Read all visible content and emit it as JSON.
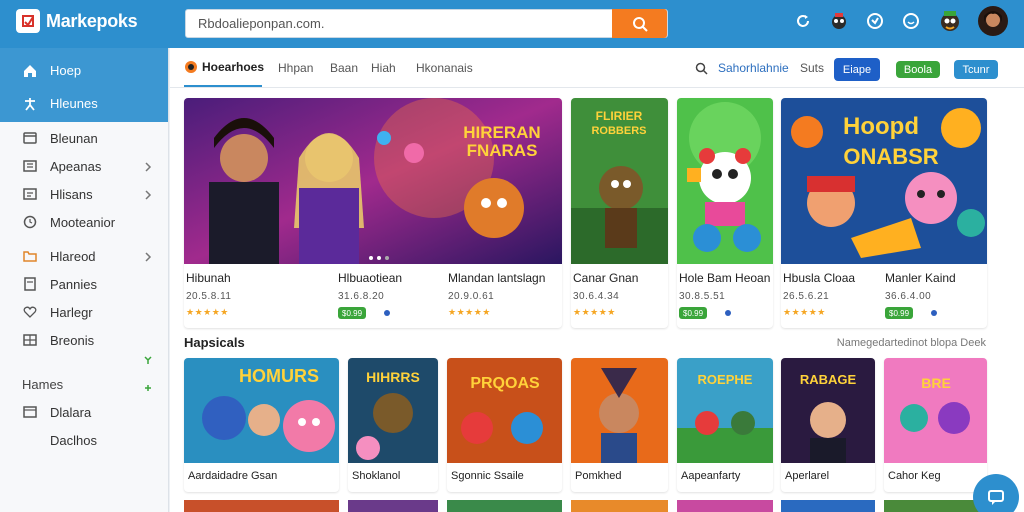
{
  "header": {
    "logo_text": "Markepoks",
    "search_value": "Rbdoalieponpan.com.",
    "search_placeholder": "Search"
  },
  "sidebar": {
    "top_items": [
      {
        "label": "Hoep",
        "icon": "home-icon"
      },
      {
        "label": "Hleunes",
        "icon": "figure-icon"
      }
    ],
    "items": [
      {
        "label": "Bleunan",
        "icon": "card-icon"
      },
      {
        "label": "Apeanas",
        "icon": "grid-icon"
      },
      {
        "label": "Hlisans",
        "icon": "list-icon"
      },
      {
        "label": "Mooteanior",
        "icon": "clock-icon"
      },
      {
        "label": "Hlareod",
        "icon": "folder-icon"
      },
      {
        "label": "Pannies",
        "icon": "doc-icon"
      },
      {
        "label": "Harlegr",
        "icon": "heart-icon"
      },
      {
        "label": "Breonis",
        "icon": "tag-icon"
      }
    ],
    "groups": [
      {
        "label": "Hames"
      },
      {
        "label": "Dlalara"
      },
      {
        "label": "Daclhos"
      }
    ]
  },
  "tabs": [
    {
      "label": "Hoearhoes",
      "active": true
    },
    {
      "label": "Hhpan"
    },
    {
      "label": "Baan"
    },
    {
      "label": "Hiah"
    },
    {
      "label": "Hkonanais"
    }
  ],
  "toolbar": {
    "search_label": "Sahorhlahnie",
    "sort_label": "Suts",
    "btn1": "Eiape",
    "btn2": "Boola",
    "btn3": "Tcunr"
  },
  "featured": [
    {
      "title": "Hibunah",
      "num": "20.5.8.11",
      "stars": "★★★★★",
      "price": ""
    },
    {
      "title": "Hlbuaotiean",
      "num": "31.6.8.20",
      "stars": "",
      "price": "$0.99"
    },
    {
      "title": "Mlandan lantslagn",
      "num": "20.9.0.61",
      "stars": "★★★★★",
      "price": ""
    },
    {
      "title": "Canar Gnan",
      "num": "30.6.4.34",
      "stars": "★★★★★",
      "price": ""
    },
    {
      "title": "Hole Bam Heoan",
      "num": "30.8.5.51",
      "stars": "",
      "price": "$0.99"
    },
    {
      "title": "Hbusla Cloaa",
      "num": "26.5.6.21",
      "stars": "★★★★★",
      "price": ""
    },
    {
      "title": "Manler Kaind",
      "num": "36.6.4.00",
      "stars": "",
      "price": "$0.99"
    }
  ],
  "section": {
    "title": "Hapsicals",
    "link": "Namegedartedinot blopa Deek"
  },
  "grid": [
    {
      "title": "Aardaidadre Gsan",
      "art": "HOMURS"
    },
    {
      "title": "Shoklanol",
      "art": "HIHRRS"
    },
    {
      "title": "Sgonnic Ssaile",
      "art": "PRQOAS"
    },
    {
      "title": "Pomkhed",
      "art": ""
    },
    {
      "title": "Aapeanfarty",
      "art": "ROEPHE"
    },
    {
      "title": "Aperlarel",
      "art": "RABAGE"
    },
    {
      "title": "Cahor Keg",
      "art": "BRE"
    }
  ],
  "hero": {
    "title_line1": "HIRERAN",
    "title_line2": "FNARAS"
  },
  "featured_art": {
    "card3_line1": "FLIRIER",
    "card3_line2": "ROBBERS",
    "card5_line1": "Hoopd",
    "card5_line2": "ONABSR"
  }
}
